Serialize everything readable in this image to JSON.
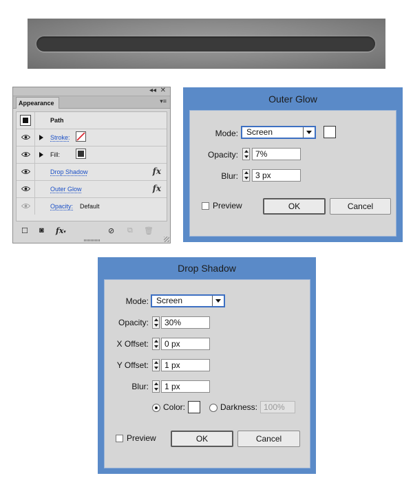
{
  "appearance_panel": {
    "tab_label": "Appearance",
    "rows": [
      {
        "label": "Path"
      },
      {
        "label": "Stroke:"
      },
      {
        "label": "Fill:"
      },
      {
        "label": "Drop Shadow"
      },
      {
        "label": "Outer Glow"
      },
      {
        "label": "Opacity:",
        "value": "Default"
      }
    ],
    "fx_symbol": "fx",
    "icons": [
      "collapse-icon",
      "close-icon",
      "panel-menu-icon",
      "eye-icon",
      "disclosure-triangle-icon",
      "fx-icon",
      "add-new-stroke-icon",
      "add-new-fill-icon",
      "add-new-effect-icon",
      "clear-appearance-icon",
      "duplicate-item-icon",
      "delete-item-icon"
    ]
  },
  "outer_glow": {
    "title": "Outer Glow",
    "mode_label": "Mode:",
    "mode_value": "Screen",
    "opacity_label": "Opacity:",
    "opacity_value": "7%",
    "blur_label": "Blur:",
    "blur_value": "3 px",
    "preview_label": "Preview",
    "ok_label": "OK",
    "cancel_label": "Cancel"
  },
  "drop_shadow": {
    "title": "Drop Shadow",
    "mode_label": "Mode:",
    "mode_value": "Screen",
    "opacity_label": "Opacity:",
    "opacity_value": "30%",
    "xoffset_label": "X Offset:",
    "xoffset_value": "0 px",
    "yoffset_label": "Y Offset:",
    "yoffset_value": "1 px",
    "blur_label": "Blur:",
    "blur_value": "1 px",
    "color_label": "Color:",
    "darkness_label": "Darkness:",
    "darkness_value": "100%",
    "preview_label": "Preview",
    "ok_label": "OK",
    "cancel_label": "Cancel"
  },
  "colors": {
    "dialog_frame": "#5a8ac8",
    "dialog_body": "#d6d6d6",
    "link": "#1a4fc6",
    "bar": "#3a3a3a"
  }
}
